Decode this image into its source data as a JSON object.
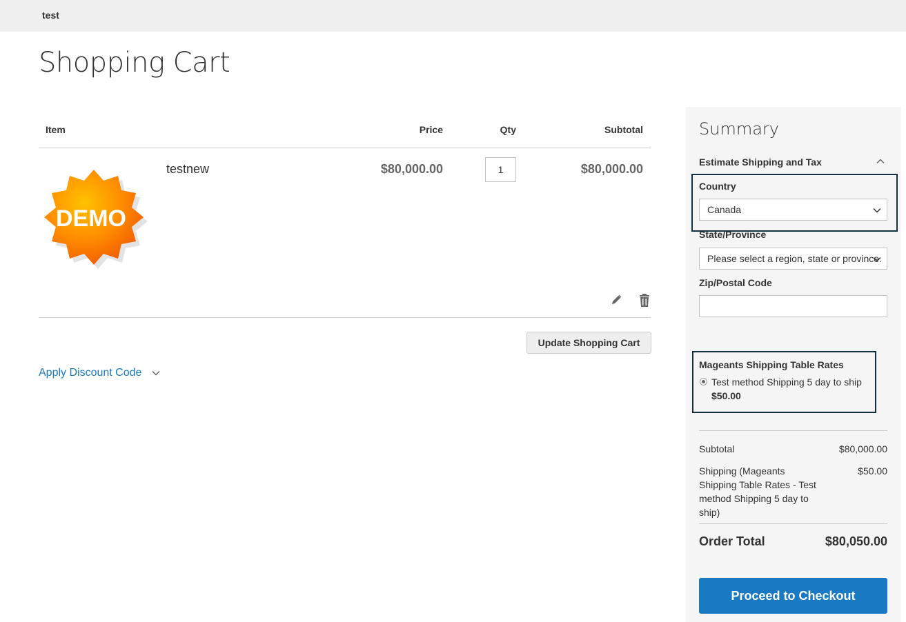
{
  "header": {
    "store_name": "test"
  },
  "page": {
    "title": "Shopping Cart"
  },
  "cart": {
    "columns": {
      "item": "Item",
      "price": "Price",
      "qty": "Qty",
      "subtotal": "Subtotal"
    },
    "items": [
      {
        "name": "testnew",
        "price": "$80,000.00",
        "qty": "1",
        "subtotal": "$80,000.00",
        "image_text": "DEMO"
      }
    ],
    "update_button": "Update Shopping Cart",
    "discount_label": "Apply Discount Code"
  },
  "summary": {
    "title": "Summary",
    "estimate_title": "Estimate Shipping and Tax",
    "country_label": "Country",
    "country_value": "Canada",
    "state_label": "State/Province",
    "state_value": "Please select a region, state or province.",
    "zip_label": "Zip/Postal Code",
    "zip_value": "",
    "shipping_carrier": "Mageants Shipping Table Rates",
    "shipping_method": "Test method Shipping 5 day to ship",
    "shipping_method_price": "$50.00",
    "subtotal_label": "Subtotal",
    "subtotal_value": "$80,000.00",
    "shipping_label": "Shipping (Mageants Shipping Table Rates - Test method Shipping 5 day to ship)",
    "shipping_value": "$50.00",
    "order_total_label": "Order Total",
    "order_total_value": "$80,050.00",
    "checkout_button": "Proceed to Checkout"
  },
  "colors": {
    "accent": "#1979c3",
    "highlight_border": "#12303e",
    "summary_bg": "#f5f5f5",
    "topbar_bg": "#f0f0f0"
  }
}
